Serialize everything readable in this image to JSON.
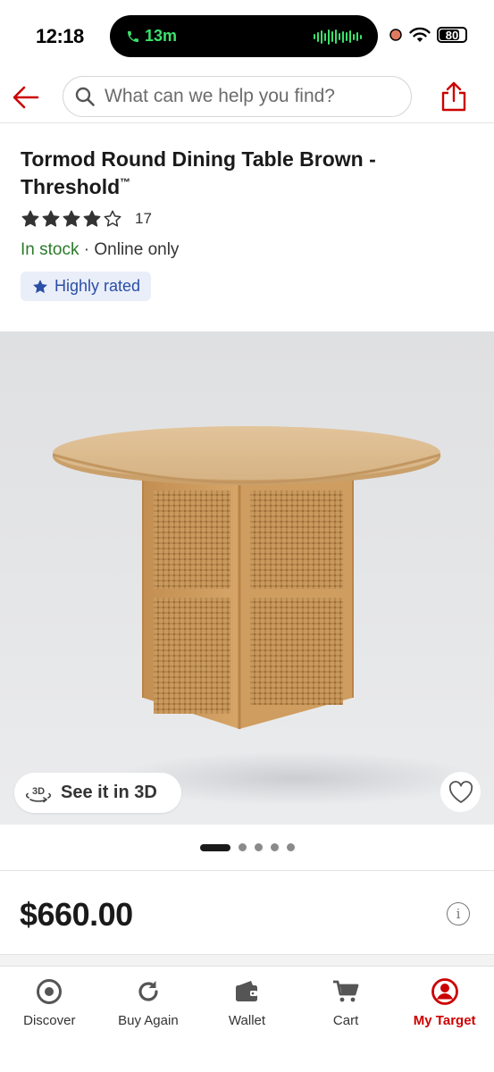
{
  "status_bar": {
    "time": "12:18",
    "call_timer": "13m",
    "battery": "80",
    "battery_level": 0.8
  },
  "header": {
    "search_placeholder": "What can we help you find?",
    "back_icon": "back-arrow-icon",
    "share_icon": "share-icon"
  },
  "product": {
    "title": "Tormod Round Dining Table Brown - Threshold",
    "trademark": "™",
    "rating": 4,
    "rating_max": 5,
    "review_count": "17",
    "stock_status": "In stock",
    "separator": " · ",
    "availability": "Online only",
    "badge": "Highly rated",
    "see_3d_label": "See it in 3D",
    "price": "$660.00"
  },
  "carousel": {
    "total": 5,
    "active_index": 0
  },
  "colors": {
    "brand_red": "#cc0000",
    "in_stock_green": "#2b7a2b",
    "badge_blue": "#2b4ea6"
  },
  "tab_bar": {
    "items": [
      {
        "label": "Discover",
        "icon": "target-discover-icon"
      },
      {
        "label": "Buy Again",
        "icon": "refresh-icon"
      },
      {
        "label": "Wallet",
        "icon": "wallet-icon"
      },
      {
        "label": "Cart",
        "icon": "cart-icon"
      },
      {
        "label": "My Target",
        "icon": "account-icon"
      }
    ],
    "active": "My Target"
  }
}
